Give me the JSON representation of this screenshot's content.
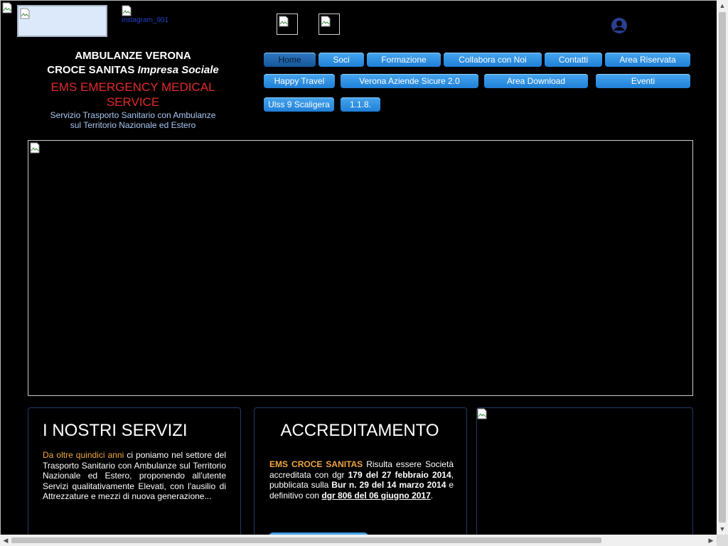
{
  "header": {
    "instagram_alt": "instagram_901"
  },
  "brand": {
    "line1": "AMBULANZE VERONA",
    "line2_main": "CROCE SANITAS ",
    "line2_italic": "Impresa Sociale",
    "line3": "EMS EMERGENCY MEDICAL SERVICE",
    "line4a": "Servizio Trasporto Sanitario con Ambulanze",
    "line4b": "sul Territorio Nazionale ed Estero"
  },
  "nav": {
    "row1": [
      "Home",
      "Soci",
      "Formazione",
      "Collabora con Noi",
      "Contatti",
      "Area Riservata"
    ],
    "row2": [
      "Happy Travel",
      "Verona Aziende Sicure 2.0",
      "Area Download",
      "Eventi"
    ],
    "row3": [
      "Ulss 9 Scaligera",
      "1.1.8."
    ],
    "active": "Home"
  },
  "services": {
    "title": "I NOSTRI SERVIZI",
    "highlight": "Da oltre quindici anni",
    "body": " ci poniamo nel settore del Trasporto Sanitario con Ambulanze sul Territorio Nazionale ed Estero, proponendo all'utente Servizi qualitativamente Elevati, con l'ausilio di Attrezzature e mezzi di nuova generazione..."
  },
  "accreditamento": {
    "title": "ACCREDITAMENTO",
    "brand": "EMS CROCE SANITAS",
    "t1": " Risulta essere Società accreditata con dgr ",
    "b1": "179 del 27 febbraio 2014",
    "t2": ", pubblicata sulla ",
    "b2": "Bur n. 29 del 14 marzo 2014",
    "t3": " e  definitivo con ",
    "link": "dgr 806 del 06 giugno 2017",
    "t4": "."
  },
  "colors": {
    "background": "#000000",
    "nav_button": "#2a8de0",
    "brand_red": "#e32a2a",
    "highlight_gold": "#f0a640",
    "subtitle_blue": "#a9c7f3"
  }
}
